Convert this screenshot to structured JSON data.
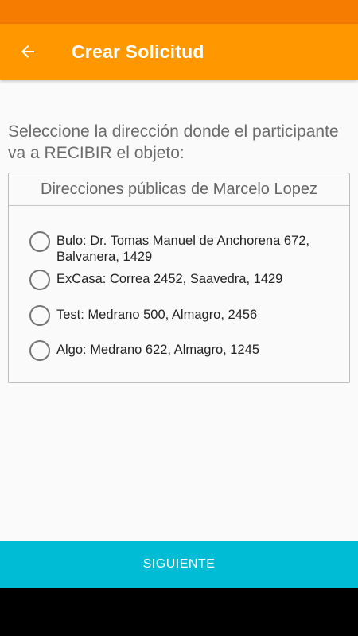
{
  "header": {
    "title": "Crear Solicitud",
    "back_icon": "arrow-left-icon"
  },
  "prompt": "Seleccione la dirección donde el participante va a RECIBIR el objeto:",
  "addresses_card": {
    "heading": "Direcciones públicas de Marcelo Lopez",
    "options": [
      {
        "label": "Bulo: Dr. Tomas Manuel de Anchorena 672, Balvanera, 1429",
        "selected": false
      },
      {
        "label": "ExCasa: Correa 2452, Saavedra, 1429",
        "selected": false
      },
      {
        "label": "Test: Medrano 500, Almagro, 2456",
        "selected": false
      },
      {
        "label": "Algo: Medrano 622, Almagro, 1245",
        "selected": false
      }
    ]
  },
  "footer": {
    "next_label": "SIGUIENTE"
  },
  "colors": {
    "status_bar": "#f57c00",
    "app_bar": "#ff9800",
    "next_button": "#00bcd4"
  }
}
